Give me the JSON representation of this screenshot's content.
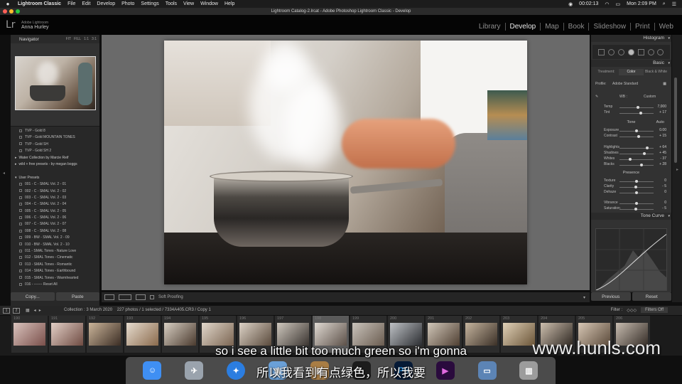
{
  "menubar": {
    "app": "Lightroom Classic",
    "items": [
      "File",
      "Edit",
      "Develop",
      "Photo",
      "Settings",
      "Tools",
      "View",
      "Window",
      "Help"
    ],
    "time_left": "00:02:13",
    "clock": "Mon 2:09 PM"
  },
  "window_title": "Lightroom Catalog-2.lrcat - Adobe Photoshop Lightroom Classic - Develop",
  "identity": {
    "logo": "Lr",
    "product": "Adobe Lightroom",
    "name": "Anna Hurley"
  },
  "modules": [
    "Library",
    "Develop",
    "Map",
    "Book",
    "Slideshow",
    "Print",
    "Web"
  ],
  "navigator": {
    "title": "Navigator",
    "zoom": [
      "FIT",
      "FILL",
      "1:1",
      "3:1"
    ]
  },
  "presets": [
    {
      "label": "TVP - Gold 8",
      "group": false
    },
    {
      "label": "TVP - Gold MOUNTAIN TONES",
      "group": false
    },
    {
      "label": "TVP - Gold SH",
      "group": false
    },
    {
      "label": "TVP - Gold SH 2",
      "group": false
    },
    {
      "label": "Water Collection by Marcie Reif",
      "group": true
    },
    {
      "label": "wild + free presets - by megan boggs",
      "group": true
    },
    {
      "label": "",
      "group": false
    },
    {
      "label": "User Presets",
      "group": true
    },
    {
      "label": "001 - C - SMAL Vol. 2 - 01",
      "group": false
    },
    {
      "label": "002 - C - SMAL Vol. 2 - 02",
      "group": false
    },
    {
      "label": "003 - C - SMAL Vol. 2 - 03",
      "group": false
    },
    {
      "label": "004 - C - SMAL Vol. 2 - 04",
      "group": false
    },
    {
      "label": "005 - C - SMAL Vol. 2 - 05",
      "group": false
    },
    {
      "label": "006 - C - SMAL Vol. 2 - 06",
      "group": false
    },
    {
      "label": "007 - C - SMAL Vol. 2 - 07",
      "group": false
    },
    {
      "label": "008 - C - SMAL Vol. 2 - 08",
      "group": false
    },
    {
      "label": "009 - BW - SMAL Vol. 2 - 09",
      "group": false
    },
    {
      "label": "010 - BW - SMAL Vol. 2 - 10",
      "group": false
    },
    {
      "label": "011 - SMAL Tones - Nature Love",
      "group": false
    },
    {
      "label": "012 - SMAL Tones - Cinematic",
      "group": false
    },
    {
      "label": "013 - SMAL Tones - Romantic",
      "group": false
    },
    {
      "label": "014 - SMAL Tones - Earthbound",
      "group": false
    },
    {
      "label": "015 - SMAL Tones - Warmhearted",
      "group": false
    },
    {
      "label": "016 - ------- Reset All",
      "group": false
    }
  ],
  "left_buttons": {
    "copy": "Copy...",
    "paste": "Paste"
  },
  "right": {
    "histogram": "Histogram",
    "basic": "Basic",
    "tabs": [
      "Treatment:",
      "Color",
      "Black & White"
    ],
    "profile_label": "Profile:",
    "profile_value": "Adobe Standard",
    "wb_label": "WB :",
    "wb_value": "Custom",
    "sliders": [
      {
        "label": "Temp",
        "value": "7,000",
        "pos": 0.55
      },
      {
        "label": "Tint",
        "value": "+ 17",
        "pos": 0.62
      },
      {
        "label": "Exposure",
        "value": "0.00",
        "pos": 0.5
      },
      {
        "label": "Contrast",
        "value": "+ 15",
        "pos": 0.57
      },
      {
        "label": "Highlights",
        "value": "+ 64",
        "pos": 0.82
      },
      {
        "label": "Shadows",
        "value": "+ 45",
        "pos": 0.72
      },
      {
        "label": "Whites",
        "value": "- 37",
        "pos": 0.31
      },
      {
        "label": "Blacks",
        "value": "+ 28",
        "pos": 0.64
      },
      {
        "label": "Texture",
        "value": "0",
        "pos": 0.5
      },
      {
        "label": "Clarity",
        "value": "- 5",
        "pos": 0.47
      },
      {
        "label": "Dehaze",
        "value": "0",
        "pos": 0.5
      },
      {
        "label": "Vibrance",
        "value": "0",
        "pos": 0.5
      },
      {
        "label": "Saturation",
        "value": "- 5",
        "pos": 0.47
      }
    ],
    "tone": "Tone",
    "auto": "Auto",
    "presence": "Presence",
    "tone_curve": "Tone Curve",
    "previous": "Previous",
    "reset": "Reset"
  },
  "toolbar": {
    "soft_proofing": "Soft Proofing"
  },
  "filmbar": {
    "pages": [
      "1",
      "2"
    ],
    "collection": "Collection : 3 March 2020",
    "count": "227 photos / 1 selected / 7334A405.CR3 / Copy 1",
    "filter_label": "Filter :",
    "filter_value": "Filters Off"
  },
  "filmstrip": [
    "190",
    "191",
    "192",
    "193",
    "194",
    "195",
    "196",
    "197",
    "198",
    "199",
    "200",
    "201",
    "202",
    "203",
    "204",
    "205",
    "206"
  ],
  "filmstrip_selected": "198",
  "dock": [
    "finder",
    "launchpad",
    "safari",
    "preview",
    "contacts",
    "lightroom",
    "photoshop",
    "premiere",
    "downloads",
    "trash"
  ],
  "dock_labels": {
    "ps": "Ps"
  },
  "subtitle_en": "so i see a little bit too much green so i'm gonna",
  "subtitle_cn": "所以我看到有点绿色，所以我要",
  "watermark": "www.hunls.com"
}
